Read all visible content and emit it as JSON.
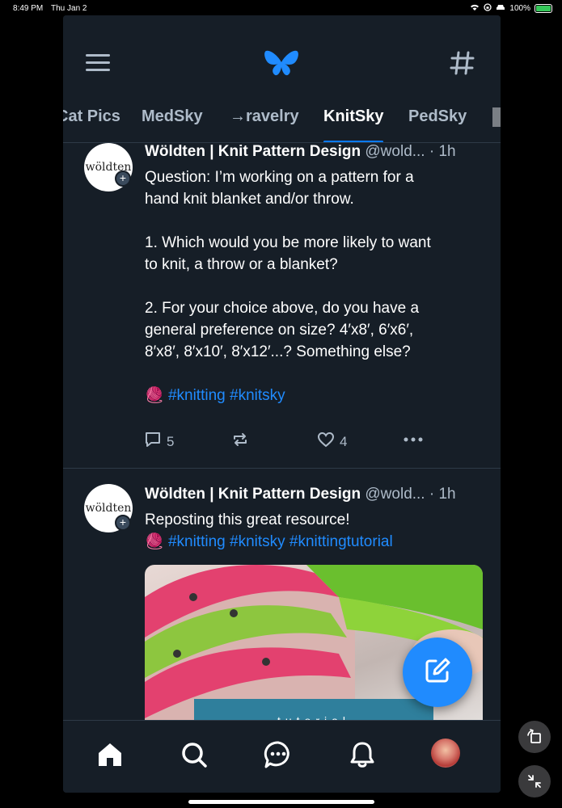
{
  "status": {
    "time": "8:49 PM",
    "date": "Thu Jan 2",
    "battery": "100%"
  },
  "header": {
    "menu_icon": "hamburger-icon",
    "logo_icon": "butterfly-icon",
    "feeds_icon": "hash-icon"
  },
  "tabs": [
    {
      "label": "Cat Pics"
    },
    {
      "label": "MedSky"
    },
    {
      "label": "→ravelry"
    },
    {
      "label": "KnitSky"
    },
    {
      "label": "PedSky"
    }
  ],
  "posts": [
    {
      "avatar_text": "wöldten",
      "author": "Wöldten | Knit Pattern Design",
      "handle": "@wold...",
      "time": "· 1h",
      "lines": [
        "Question: I’m working on a pattern for a",
        "hand knit blanket and/or throw.",
        "",
        "1. Which would you be more likely to want",
        "to knit, a throw or a blanket?",
        "",
        "2. For your choice above, do you have a",
        "general preference on size? 4′x8′, 6′x6′,",
        "8′x8′, 8′x10′, 8′x12′...? Something else?"
      ],
      "tag_emoji": "🧶",
      "tags": "#knitting #knitsky",
      "replies": "5",
      "likes": "4"
    },
    {
      "avatar_text": "wöldten",
      "author": "Wöldten | Knit Pattern Design",
      "handle": "@wold...",
      "time": "· 1h",
      "text": "Reposting this great resource!",
      "tag_emoji": "🧶",
      "tags": "#knitting #knitsky #knittingtutorial",
      "media_caption": "tutorial"
    }
  ],
  "colors": {
    "background": "#161e27",
    "accent": "#208bfe",
    "muted": "#aebbc9"
  }
}
